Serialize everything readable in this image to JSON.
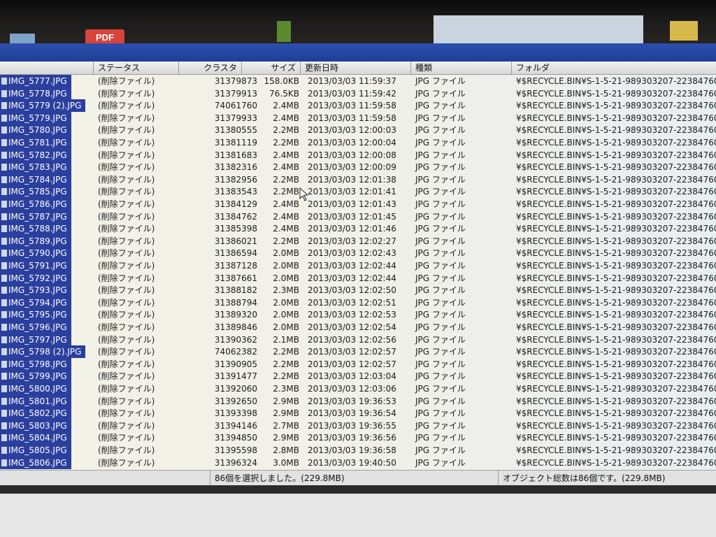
{
  "background": {
    "pdf_label": "PDF"
  },
  "columns": {
    "status": "ステータス",
    "cluster": "クラスタ",
    "size": "サイズ",
    "modified": "更新日時",
    "type": "種類",
    "folder": "フォルダ"
  },
  "rows": [
    {
      "name": "IMG_5777.JPG",
      "status": "(削除ファイル)",
      "cluster": "31379873",
      "size": "158.0KB",
      "date": "2013/03/03  11:59:37",
      "type": "JPG ファイル",
      "folder": "¥$RECYCLE.BIN¥S-1-5-21-989303207-22384760"
    },
    {
      "name": "IMG_5778.JPG",
      "status": "(削除ファイル)",
      "cluster": "31379913",
      "size": "76.5KB",
      "date": "2013/03/03  11:59:42",
      "type": "JPG ファイル",
      "folder": "¥$RECYCLE.BIN¥S-1-5-21-989303207-22384760"
    },
    {
      "name": "IMG_5779 (2).JPG",
      "status": "(削除ファイル)",
      "cluster": "74061760",
      "size": "2.4MB",
      "date": "2013/03/03  11:59:58",
      "type": "JPG ファイル",
      "folder": "¥$RECYCLE.BIN¥S-1-5-21-989303207-22384760"
    },
    {
      "name": "IMG_5779.JPG",
      "status": "(削除ファイル)",
      "cluster": "31379933",
      "size": "2.4MB",
      "date": "2013/03/03  11:59:58",
      "type": "JPG ファイル",
      "folder": "¥$RECYCLE.BIN¥S-1-5-21-989303207-22384760"
    },
    {
      "name": "IMG_5780.JPG",
      "status": "(削除ファイル)",
      "cluster": "31380555",
      "size": "2.2MB",
      "date": "2013/03/03  12:00:03",
      "type": "JPG ファイル",
      "folder": "¥$RECYCLE.BIN¥S-1-5-21-989303207-22384760"
    },
    {
      "name": "IMG_5781.JPG",
      "status": "(削除ファイル)",
      "cluster": "31381119",
      "size": "2.2MB",
      "date": "2013/03/03  12:00:04",
      "type": "JPG ファイル",
      "folder": "¥$RECYCLE.BIN¥S-1-5-21-989303207-22384760"
    },
    {
      "name": "IMG_5782.JPG",
      "status": "(削除ファイル)",
      "cluster": "31381683",
      "size": "2.4MB",
      "date": "2013/03/03  12:00:08",
      "type": "JPG ファイル",
      "folder": "¥$RECYCLE.BIN¥S-1-5-21-989303207-22384760"
    },
    {
      "name": "IMG_5783.JPG",
      "status": "(削除ファイル)",
      "cluster": "31382316",
      "size": "2.4MB",
      "date": "2013/03/03  12:00:09",
      "type": "JPG ファイル",
      "folder": "¥$RECYCLE.BIN¥S-1-5-21-989303207-22384760"
    },
    {
      "name": "IMG_5784.JPG",
      "status": "(削除ファイル)",
      "cluster": "31382956",
      "size": "2.2MB",
      "date": "2013/03/03  12:01:38",
      "type": "JPG ファイル",
      "folder": "¥$RECYCLE.BIN¥S-1-5-21-989303207-22384760"
    },
    {
      "name": "IMG_5785.JPG",
      "status": "(削除ファイル)",
      "cluster": "31383543",
      "size": "2.2MB",
      "date": "2013/03/03  12:01:41",
      "type": "JPG ファイル",
      "folder": "¥$RECYCLE.BIN¥S-1-5-21-989303207-22384760"
    },
    {
      "name": "IMG_5786.JPG",
      "status": "(削除ファイル)",
      "cluster": "31384129",
      "size": "2.4MB",
      "date": "2013/03/03  12:01:43",
      "type": "JPG ファイル",
      "folder": "¥$RECYCLE.BIN¥S-1-5-21-989303207-22384760"
    },
    {
      "name": "IMG_5787.JPG",
      "status": "(削除ファイル)",
      "cluster": "31384762",
      "size": "2.4MB",
      "date": "2013/03/03  12:01:45",
      "type": "JPG ファイル",
      "folder": "¥$RECYCLE.BIN¥S-1-5-21-989303207-22384760"
    },
    {
      "name": "IMG_5788.JPG",
      "status": "(削除ファイル)",
      "cluster": "31385398",
      "size": "2.4MB",
      "date": "2013/03/03  12:01:46",
      "type": "JPG ファイル",
      "folder": "¥$RECYCLE.BIN¥S-1-5-21-989303207-22384760"
    },
    {
      "name": "IMG_5789.JPG",
      "status": "(削除ファイル)",
      "cluster": "31386021",
      "size": "2.2MB",
      "date": "2013/03/03  12:02:27",
      "type": "JPG ファイル",
      "folder": "¥$RECYCLE.BIN¥S-1-5-21-989303207-22384760"
    },
    {
      "name": "IMG_5790.JPG",
      "status": "(削除ファイル)",
      "cluster": "31386594",
      "size": "2.0MB",
      "date": "2013/03/03  12:02:43",
      "type": "JPG ファイル",
      "folder": "¥$RECYCLE.BIN¥S-1-5-21-989303207-22384760"
    },
    {
      "name": "IMG_5791.JPG",
      "status": "(削除ファイル)",
      "cluster": "31387128",
      "size": "2.0MB",
      "date": "2013/03/03  12:02:44",
      "type": "JPG ファイル",
      "folder": "¥$RECYCLE.BIN¥S-1-5-21-989303207-22384760"
    },
    {
      "name": "IMG_5792.JPG",
      "status": "(削除ファイル)",
      "cluster": "31387661",
      "size": "2.0MB",
      "date": "2013/03/03  12:02:44",
      "type": "JPG ファイル",
      "folder": "¥$RECYCLE.BIN¥S-1-5-21-989303207-22384760"
    },
    {
      "name": "IMG_5793.JPG",
      "status": "(削除ファイル)",
      "cluster": "31388182",
      "size": "2.3MB",
      "date": "2013/03/03  12:02:50",
      "type": "JPG ファイル",
      "folder": "¥$RECYCLE.BIN¥S-1-5-21-989303207-22384760"
    },
    {
      "name": "IMG_5794.JPG",
      "status": "(削除ファイル)",
      "cluster": "31388794",
      "size": "2.0MB",
      "date": "2013/03/03  12:02:51",
      "type": "JPG ファイル",
      "folder": "¥$RECYCLE.BIN¥S-1-5-21-989303207-22384760"
    },
    {
      "name": "IMG_5795.JPG",
      "status": "(削除ファイル)",
      "cluster": "31389320",
      "size": "2.0MB",
      "date": "2013/03/03  12:02:53",
      "type": "JPG ファイル",
      "folder": "¥$RECYCLE.BIN¥S-1-5-21-989303207-22384760"
    },
    {
      "name": "IMG_5796.JPG",
      "status": "(削除ファイル)",
      "cluster": "31389846",
      "size": "2.0MB",
      "date": "2013/03/03  12:02:54",
      "type": "JPG ファイル",
      "folder": "¥$RECYCLE.BIN¥S-1-5-21-989303207-22384760"
    },
    {
      "name": "IMG_5797.JPG",
      "status": "(削除ファイル)",
      "cluster": "31390362",
      "size": "2.1MB",
      "date": "2013/03/03  12:02:56",
      "type": "JPG ファイル",
      "folder": "¥$RECYCLE.BIN¥S-1-5-21-989303207-22384760"
    },
    {
      "name": "IMG_5798 (2).JPG",
      "status": "(削除ファイル)",
      "cluster": "74062382",
      "size": "2.2MB",
      "date": "2013/03/03  12:02:57",
      "type": "JPG ファイル",
      "folder": "¥$RECYCLE.BIN¥S-1-5-21-989303207-22384760"
    },
    {
      "name": "IMG_5798.JPG",
      "status": "(削除ファイル)",
      "cluster": "31390905",
      "size": "2.2MB",
      "date": "2013/03/03  12:02:57",
      "type": "JPG ファイル",
      "folder": "¥$RECYCLE.BIN¥S-1-5-21-989303207-22384760"
    },
    {
      "name": "IMG_5799.JPG",
      "status": "(削除ファイル)",
      "cluster": "31391477",
      "size": "2.2MB",
      "date": "2013/03/03  12:03:04",
      "type": "JPG ファイル",
      "folder": "¥$RECYCLE.BIN¥S-1-5-21-989303207-22384760"
    },
    {
      "name": "IMG_5800.JPG",
      "status": "(削除ファイル)",
      "cluster": "31392060",
      "size": "2.3MB",
      "date": "2013/03/03  12:03:06",
      "type": "JPG ファイル",
      "folder": "¥$RECYCLE.BIN¥S-1-5-21-989303207-22384760"
    },
    {
      "name": "IMG_5801.JPG",
      "status": "(削除ファイル)",
      "cluster": "31392650",
      "size": "2.9MB",
      "date": "2013/03/03  19:36:53",
      "type": "JPG ファイル",
      "folder": "¥$RECYCLE.BIN¥S-1-5-21-989303207-22384760"
    },
    {
      "name": "IMG_5802.JPG",
      "status": "(削除ファイル)",
      "cluster": "31393398",
      "size": "2.9MB",
      "date": "2013/03/03  19:36:54",
      "type": "JPG ファイル",
      "folder": "¥$RECYCLE.BIN¥S-1-5-21-989303207-22384760"
    },
    {
      "name": "IMG_5803.JPG",
      "status": "(削除ファイル)",
      "cluster": "31394146",
      "size": "2.7MB",
      "date": "2013/03/03  19:36:55",
      "type": "JPG ファイル",
      "folder": "¥$RECYCLE.BIN¥S-1-5-21-989303207-22384760"
    },
    {
      "name": "IMG_5804.JPG",
      "status": "(削除ファイル)",
      "cluster": "31394850",
      "size": "2.9MB",
      "date": "2013/03/03  19:36:56",
      "type": "JPG ファイル",
      "folder": "¥$RECYCLE.BIN¥S-1-5-21-989303207-22384760"
    },
    {
      "name": "IMG_5805.JPG",
      "status": "(削除ファイル)",
      "cluster": "31395598",
      "size": "2.8MB",
      "date": "2013/03/03  19:36:58",
      "type": "JPG ファイル",
      "folder": "¥$RECYCLE.BIN¥S-1-5-21-989303207-22384760"
    },
    {
      "name": "IMG_5806.JPG",
      "status": "(削除ファイル)",
      "cluster": "31396324",
      "size": "3.0MB",
      "date": "2013/03/03  19:40:50",
      "type": "JPG ファイル",
      "folder": "¥$RECYCLE.BIN¥S-1-5-21-989303207-22384760"
    }
  ],
  "status": {
    "selected": "86個を選択しました。(229.8MB)",
    "total": "オブジェクト総数は86個です。(229.8MB)"
  },
  "colors": {
    "selection": "#2b3f9e",
    "titlebar": "#2c4fae"
  },
  "toolbar_icons": [
    "file-icon",
    "file-copy-icon",
    "tree-icon",
    "tree-expand-icon",
    "details-view-icon",
    "search-icon",
    "play-icon",
    "pause-icon",
    "stop-icon"
  ]
}
